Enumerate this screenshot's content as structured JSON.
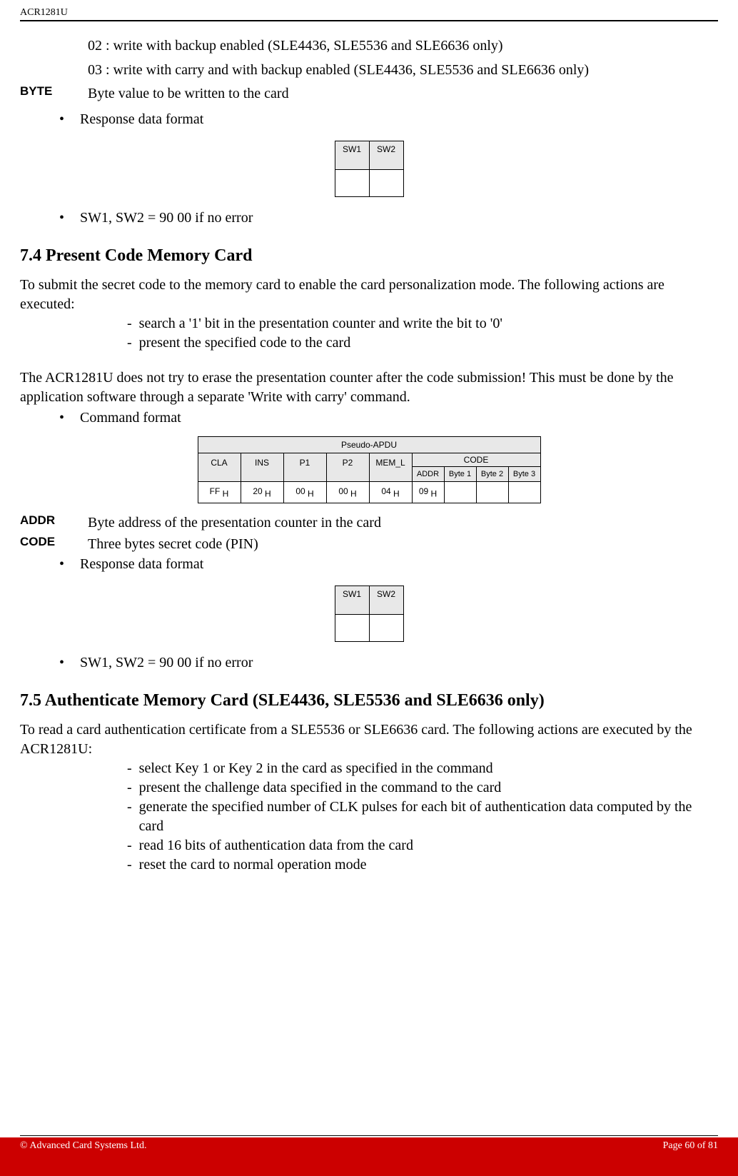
{
  "header": {
    "doc_id": "ACR1281U"
  },
  "intro": {
    "line02": "02 :  write with backup enabled (SLE4436, SLE5536 and SLE6636 only)",
    "line03": "03 :  write with carry and with backup enabled (SLE4436, SLE5536 and SLE6636 only)",
    "byte_label": "BYTE",
    "byte_text": "Byte value to be written to the card",
    "bullet_response": "Response data format",
    "sw1": "SW1",
    "sw2": "SW2",
    "sw_bullet": "SW1, SW2      = 90 00 if no error"
  },
  "sec74": {
    "heading": "7.4 Present Code Memory Card",
    "para1": "To submit the secret code to the memory card to enable the card personalization mode. The following actions are executed:",
    "dash1": "search a '1' bit in the presentation counter and write the bit to '0'",
    "dash2": "present the specified code to the card",
    "para2": "The ACR1281U does not try to erase the presentation counter after the code submission! This must be done by the application software through a separate  'Write with carry' command.",
    "bullet_cmd": "Command format",
    "apdu": {
      "title": "Pseudo-APDU",
      "h_cla": "CLA",
      "h_ins": "INS",
      "h_p1": "P1",
      "h_p2": "P2",
      "h_meml": "MEM_L",
      "h_code": "CODE",
      "h_addr": "ADDR",
      "h_b1": "Byte 1",
      "h_b2": "Byte 2",
      "h_b3": "Byte 3",
      "d_cla": "FF",
      "d_ins": "20",
      "d_p1": "00",
      "d_p2": "00",
      "d_meml": "04",
      "d_addr": "09"
    },
    "addr_label": "ADDR",
    "addr_text": "Byte address of the presentation counter in the card",
    "code_label": "CODE",
    "code_text": "Three bytes secret code (PIN)",
    "bullet_response": "Response data format",
    "sw1": "SW1",
    "sw2": "SW2",
    "sw_bullet": "SW1, SW2      = 90 00 if no error"
  },
  "sec75": {
    "heading": "7.5 Authenticate Memory Card (SLE4436, SLE5536 and SLE6636 only)",
    "para1": "To read a card authentication certificate from a SLE5536 or SLE6636 card. The following actions are executed by the ACR1281U:",
    "dash1": "select Key 1 or Key 2 in the card as specified in the command",
    "dash2": "present the challenge data specified in the command to the card",
    "dash3": "generate the specified number of CLK pulses for each bit of authentication data computed by the card",
    "dash4": "read 16 bits of authentication data from the card",
    "dash5": "reset the card to normal operation mode"
  },
  "footer": {
    "left": "© Advanced Card Systems Ltd.",
    "right": "Page 60 of 81"
  }
}
